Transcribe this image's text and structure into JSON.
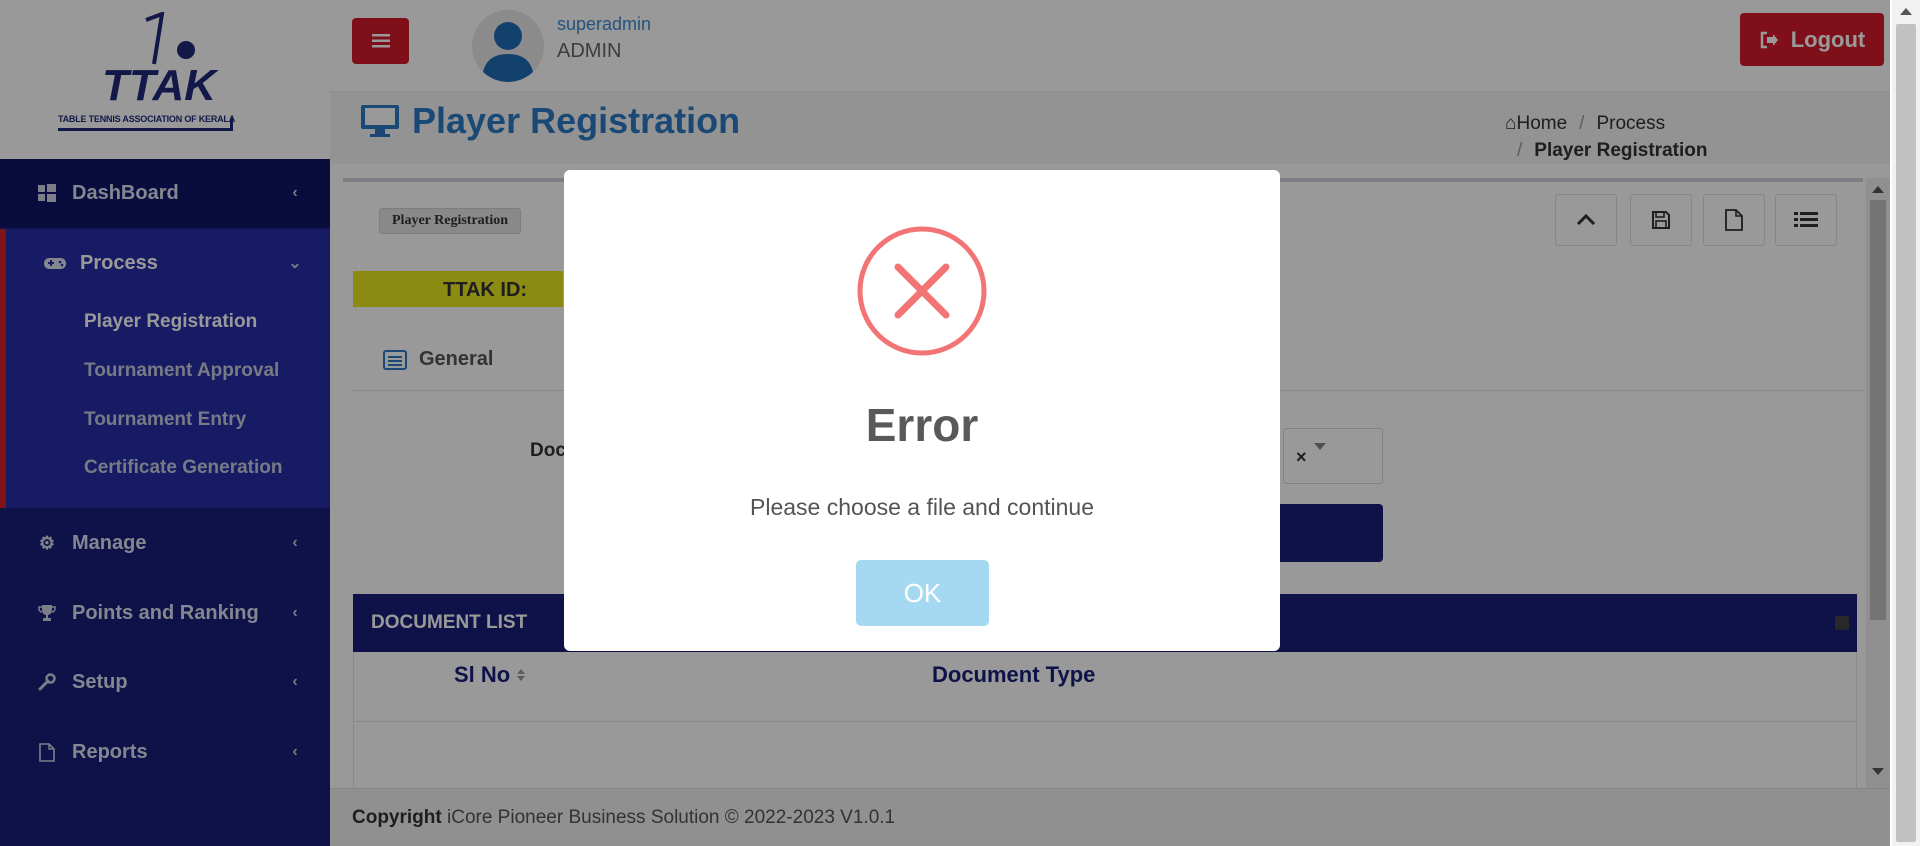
{
  "app": {
    "logo_text": "TTAK",
    "logo_caption": "TABLE TENNIS ASSOCIATION OF KERALA",
    "accent_color": "#d41c2a",
    "sidebar_color": "#1a1f7a"
  },
  "header": {
    "user_name": "superadmin",
    "user_role": "ADMIN",
    "logout_label": "Logout"
  },
  "sidebar": {
    "items": [
      {
        "label": "DashBoard",
        "icon": "windows-icon"
      },
      {
        "label": "Process",
        "icon": "gamepad-icon",
        "expanded": true
      },
      {
        "label": "Manage",
        "icon": "gear-icon"
      },
      {
        "label": "Points and Ranking",
        "icon": "trophy-icon"
      },
      {
        "label": "Setup",
        "icon": "wrench-icon"
      },
      {
        "label": "Reports",
        "icon": "file-pdf-icon"
      }
    ],
    "process_sub": [
      {
        "label": "Player Registration",
        "active": true
      },
      {
        "label": "Tournament Approval"
      },
      {
        "label": "Tournament Entry"
      },
      {
        "label": "Certificate Generation"
      }
    ]
  },
  "page": {
    "title": "Player Registration",
    "breadcrumb": {
      "home": "Home",
      "section": "Process",
      "current": "Player Registration"
    }
  },
  "content": {
    "tag": "Player Registration",
    "ttak_id_label": "TTAK ID:",
    "tab_general": "General",
    "doc_label": "Doc",
    "select_clear": "×",
    "doc_list_title": "DOCUMENT LIST",
    "columns": [
      "Sl No",
      "Document Type"
    ]
  },
  "footer": {
    "copyright_label": "Copyright",
    "copyright_text": "iCore Pioneer Business Solution © 2022-2023 V1.0.1"
  },
  "modal": {
    "icon": "error-x-icon",
    "title": "Error",
    "message": "Please choose a file and continue",
    "ok_label": "OK"
  }
}
